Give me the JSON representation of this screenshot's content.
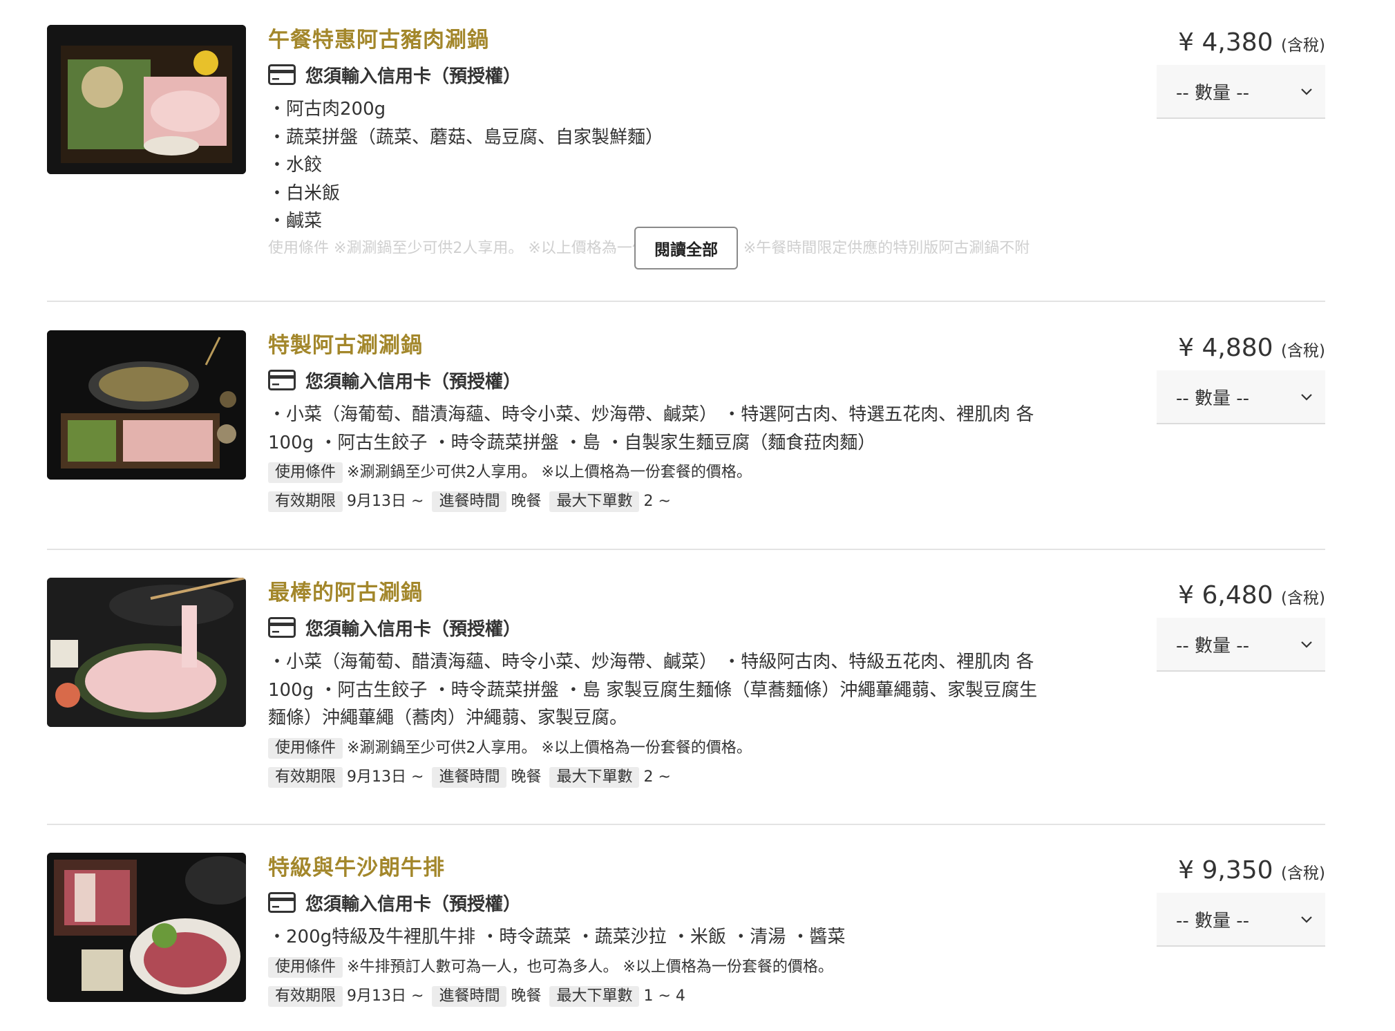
{
  "courses": [
    {
      "title": "午餐特惠阿古豬肉涮鍋",
      "card_note": "您須輸入信用卡（預授權）",
      "desc": [
        "・阿古肉200g",
        "・蔬菜拼盤（蔬菜、蘑菇、島豆腐、自家製鮮麵）",
        "・水餃",
        "・白米飯",
        "・鹹菜"
      ],
      "faded_text": "使用條件  ※涮涮鍋至少可供2人享用。 ※以上價格為一份套餐的價格。 ※午餐時間限定供應的特別版阿古涮鍋不附",
      "read_more": "閱讀全部",
      "price": "¥ 4,380",
      "tax": "(含稅)",
      "qty_placeholder": "-- 數量 --"
    },
    {
      "title": "特製阿古涮涮鍋",
      "card_note": "您須輸入信用卡（預授權）",
      "desc_line1": "・小菜（海葡萄、醋漬海蘊、時令小菜、炒海帶、鹹菜） ・特選阿古肉、特選五花肉、裡肌肉 各",
      "desc_line2": "100g ・阿古生餃子 ・時令蔬菜拼盤 ・島 ・自製家生麵豆腐（麵食菈肉麵）",
      "cond_label": "使用條件",
      "cond_text": "※涮涮鍋至少可供2人享用。 ※以上價格為一份套餐的價格。",
      "valid_label": "有效期限",
      "valid_value": "9月13日 ~",
      "time_label": "進餐時間",
      "time_value": "晚餐",
      "max_label": "最大下單數",
      "max_value": "2 ~",
      "price": "¥ 4,880",
      "tax": "(含稅)",
      "qty_placeholder": "-- 數量 --"
    },
    {
      "title": "最棒的阿古涮鍋",
      "card_note": "您須輸入信用卡（預授權）",
      "desc_line1": "・小菜（海葡萄、醋漬海蘊、時令小菜、炒海帶、鹹菜） ・特級阿古肉、特級五花肉、裡肌肉 各",
      "desc_line2": "100g ・阿古生餃子 ・時令蔬菜拼盤 ・島 家製豆腐生麵條（草蕎麵條）沖繩蓽繩蒻、家製豆腐生",
      "desc_line3": "麵條）沖繩蓽繩（蕎肉）沖繩蒻、家製豆腐。",
      "cond_label": "使用條件",
      "cond_text": "※涮涮鍋至少可供2人享用。 ※以上價格為一份套餐的價格。",
      "valid_label": "有效期限",
      "valid_value": "9月13日 ~",
      "time_label": "進餐時間",
      "time_value": "晚餐",
      "max_label": "最大下單數",
      "max_value": "2 ~",
      "price": "¥ 6,480",
      "tax": "(含稅)",
      "qty_placeholder": "-- 數量 --"
    },
    {
      "title": "特級與牛沙朗牛排",
      "card_note": "您須輸入信用卡（預授權）",
      "desc_line1": "・200g特級及牛裡肌牛排 ・時令蔬菜 ・蔬菜沙拉 ・米飯 ・清湯 ・醬菜",
      "cond_label": "使用條件",
      "cond_text": "※牛排預訂人數可為一人，也可為多人。 ※以上價格為一份套餐的價格。",
      "valid_label": "有效期限",
      "valid_value": "9月13日 ~",
      "time_label": "進餐時間",
      "time_value": "晚餐",
      "max_label": "最大下單數",
      "max_value": "1 ~ 4",
      "price": "¥ 9,350",
      "tax": "(含稅)",
      "qty_placeholder": "-- 數量 --"
    }
  ]
}
